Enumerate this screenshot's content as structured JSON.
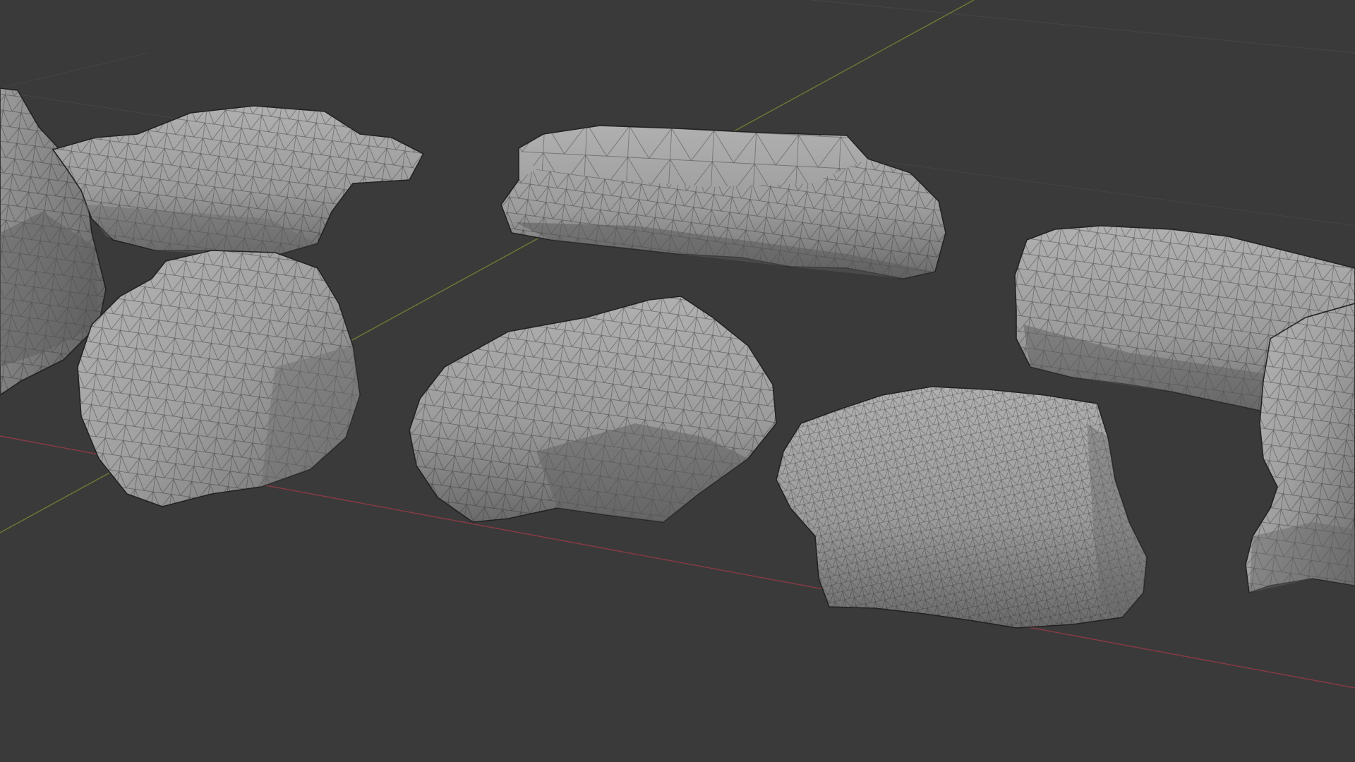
{
  "viewport": {
    "background_color": "#3a3a3a",
    "grid_line_color": "#444444",
    "x_axis_color": "#8a3a44",
    "y_axis_color": "#6f7a32",
    "rock_light_color": "#a9a9a9",
    "rock_mid_color": "#8e8e8e",
    "rock_shadow_color": "#5e5e5e",
    "wire_color": "#2a2a2a",
    "objects": [
      {
        "name": "rock-far-left"
      },
      {
        "name": "rock-top-left-flat"
      },
      {
        "name": "rock-left-boulder"
      },
      {
        "name": "rock-top-center-slab"
      },
      {
        "name": "rock-center"
      },
      {
        "name": "rock-center-right-dense"
      },
      {
        "name": "rock-right-slab"
      },
      {
        "name": "rock-far-right"
      }
    ]
  }
}
